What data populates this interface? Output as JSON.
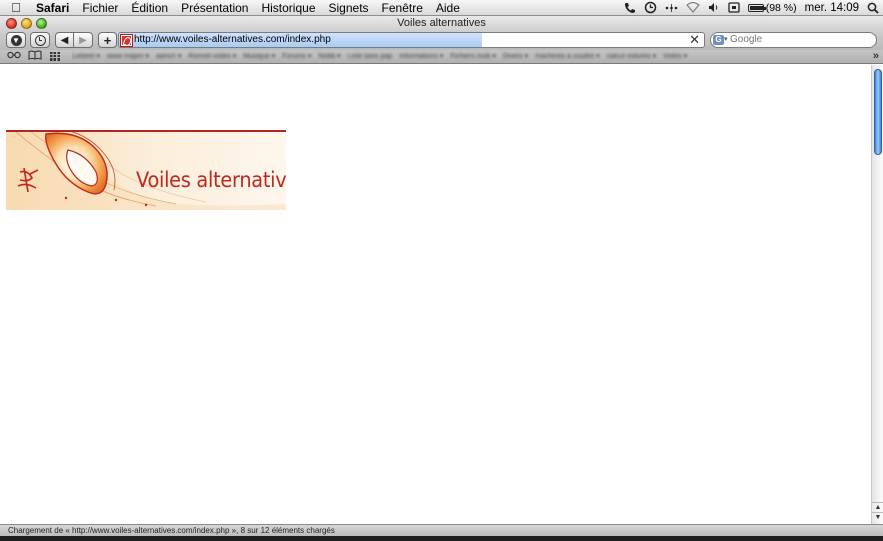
{
  "menubar": {
    "apple_icon": "apple-icon",
    "app_name": "Safari",
    "items": [
      "Fichier",
      "Édition",
      "Présentation",
      "Historique",
      "Signets",
      "Fenêtre",
      "Aide"
    ],
    "battery_label": "(98 %)",
    "battery_level": 0.98,
    "clock": "mer. 14:09"
  },
  "window": {
    "title": "Voiles alternatives"
  },
  "toolbar": {
    "back_glyph": "◀",
    "forward_glyph": "▶",
    "add_glyph": "+",
    "address_url": "http://www.voiles-alternatives.com/index.php",
    "address_clear_glyph": "✕",
    "load_progress": 0.62,
    "search_placeholder": "Google",
    "search_engine_glyph": "G"
  },
  "bookmarks": {
    "items": [
      "Liebeel ▾",
      "www mapm ▾",
      "aancrr ▾",
      "Ronnet voiles ▾",
      "Musique ▾",
      "Forums ▾",
      "Nobb ▾",
      "Liste taxis pap",
      "Informations ▾",
      "Fichiers mob ▾",
      "Divers ▾",
      "machines à coudre ▾",
      "calcul voilures ▾",
      "Voiles ▾"
    ],
    "more_glyph": "»"
  },
  "page": {
    "banner_title": "Voiles alternatives"
  },
  "scrollbar": {
    "up_glyph": "▲",
    "down_glyph": "▼"
  },
  "status": {
    "text": "Chargement de « http://www.voiles-alternatives.com/index.php », 8 sur 12 éléments chargés"
  },
  "colors": {
    "brand_red": "#c0281e",
    "accent_blue": "#3b82d6"
  }
}
